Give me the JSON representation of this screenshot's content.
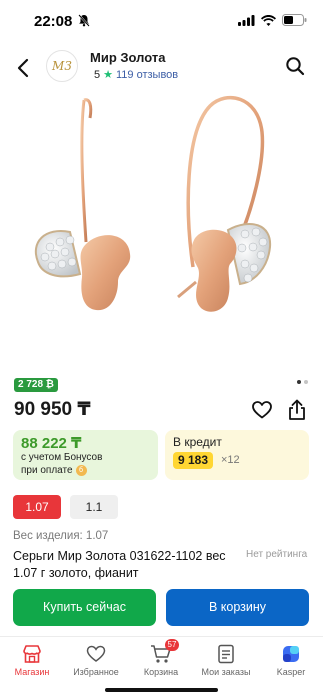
{
  "status": {
    "time": "22:08"
  },
  "header": {
    "shop_name": "Мир Золота",
    "rating": "5",
    "reviews": "119 отзывов"
  },
  "gallery": {
    "dots": 2,
    "active": 1
  },
  "product": {
    "bonus_badge": "2 728 ₿",
    "price": "90 950 ₸",
    "bonus_price": "88 222 ₸",
    "bonus_note_line1": "с учетом Бонусов",
    "bonus_note_line2": "при оплате",
    "credit_title": "В кредит",
    "credit_payment": "9 183",
    "credit_months": "×12",
    "variants": [
      "1.07",
      "1.1"
    ],
    "article": "Вес изделия: 1.07",
    "title": "Серьги Мир Золота 031622-1102 вес 1.07 г золото, фианит",
    "no_rating": "Нет рейтинга"
  },
  "actions": {
    "buy_now": "Купить сейчас",
    "to_cart": "В корзину"
  },
  "tabbar": {
    "items": [
      {
        "label": "Магазин",
        "icon": "shop-icon",
        "active": true
      },
      {
        "label": "Избранное",
        "icon": "heart-icon"
      },
      {
        "label": "Корзина",
        "icon": "cart-icon",
        "badge": "57"
      },
      {
        "label": "Мои заказы",
        "icon": "orders-icon"
      },
      {
        "label": "Kasper",
        "icon": "kaspi-logo-icon"
      }
    ]
  },
  "colors": {
    "accent_red": "#e8363a",
    "buy_green": "#11a84a",
    "cart_blue": "#0b66c6",
    "bonus_green": "#3d9a2a",
    "credit_yellow": "#ffd633"
  }
}
